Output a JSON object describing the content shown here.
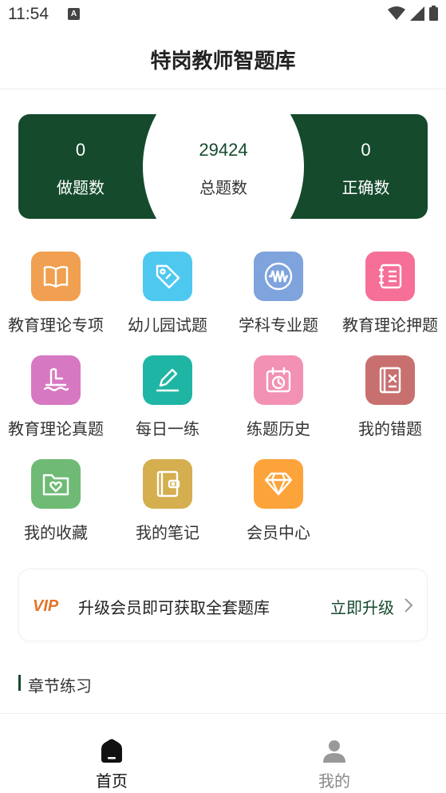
{
  "status_bar": {
    "time": "11:54",
    "notification_badge": "A"
  },
  "header": {
    "title": "特岗教师智题库"
  },
  "stats": {
    "done": {
      "value": "0",
      "label": "做题数"
    },
    "total": {
      "value": "29424",
      "label": "总题数"
    },
    "correct": {
      "value": "0",
      "label": "正确数"
    }
  },
  "grid": [
    {
      "label": "教育理论专项",
      "icon": "book-icon",
      "color": "#f0a050"
    },
    {
      "label": "幼儿园试题",
      "icon": "tag-icon",
      "color": "#4fc8f0"
    },
    {
      "label": "学科专业题",
      "icon": "waveform-icon",
      "color": "#7fa3dc"
    },
    {
      "label": "教育理论押题",
      "icon": "notebook-icon",
      "color": "#f56f97"
    },
    {
      "label": "教育理论真题",
      "icon": "sailboat-icon",
      "color": "#d778c2"
    },
    {
      "label": "每日一练",
      "icon": "pencil-icon",
      "color": "#1fb5a5"
    },
    {
      "label": "练题历史",
      "icon": "calendar-history-icon",
      "color": "#f291b4"
    },
    {
      "label": "我的错题",
      "icon": "error-book-icon",
      "color": "#c87070"
    },
    {
      "label": "我的收藏",
      "icon": "heart-folder-icon",
      "color": "#6fba74"
    },
    {
      "label": "我的笔记",
      "icon": "wallet-notebook-icon",
      "color": "#d4ae4f"
    },
    {
      "label": "会员中心",
      "icon": "diamond-icon",
      "color": "#fca33a"
    }
  ],
  "vip": {
    "badge": "VIP",
    "text": "升级会员即可获取全套题库",
    "action": "立即升级"
  },
  "section": {
    "title": "章节练习"
  },
  "bottom_nav": {
    "home": "首页",
    "mine": "我的"
  },
  "colors": {
    "primary": "#154a2d",
    "vip_orange": "#e3742a"
  }
}
